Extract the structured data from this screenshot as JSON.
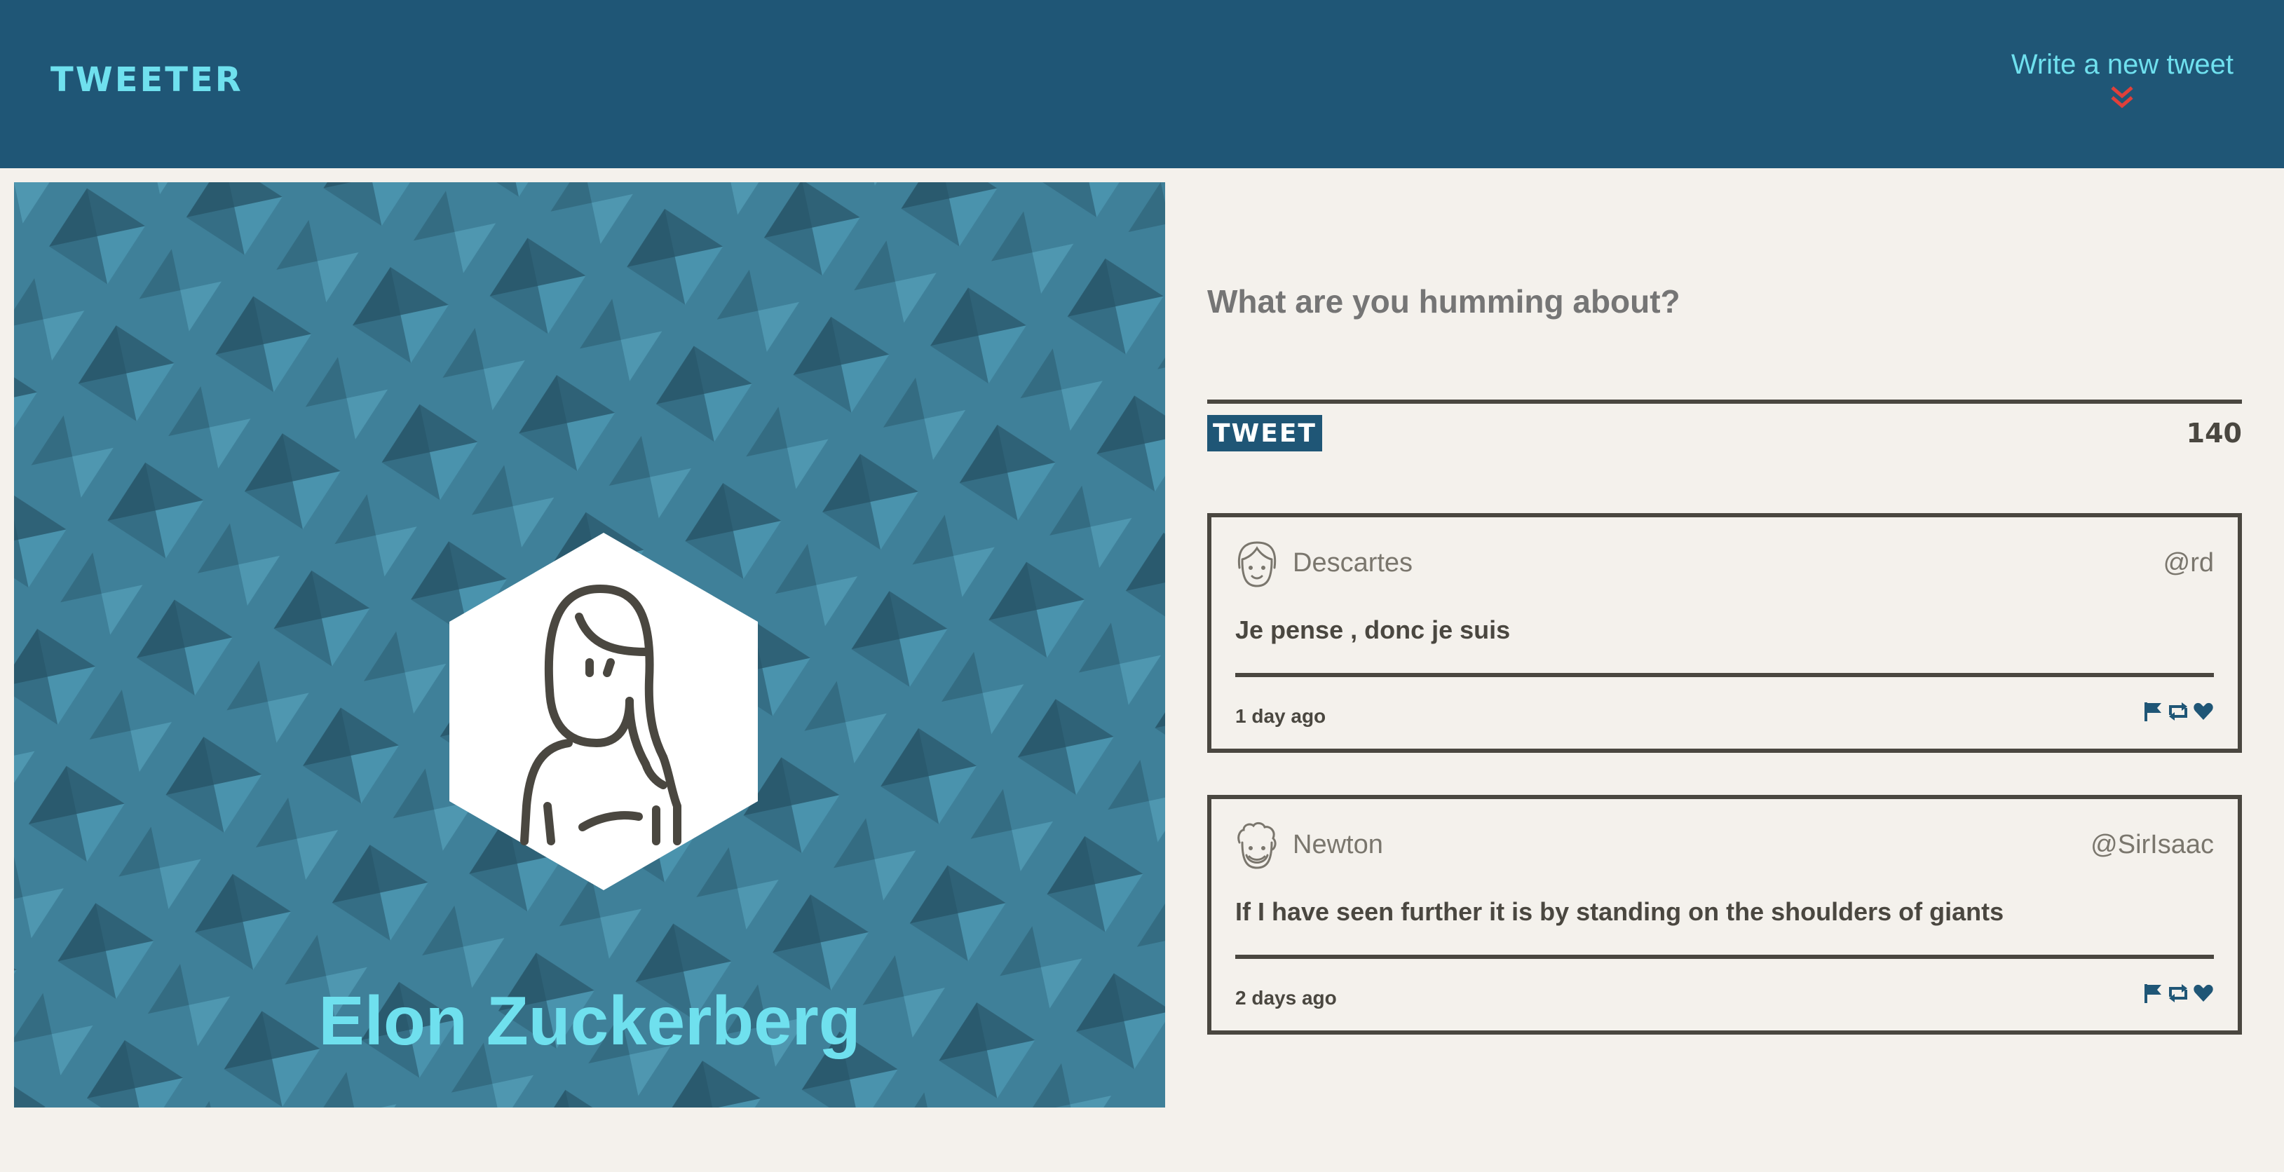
{
  "header": {
    "logo": "TWEETER",
    "compose_link": "Write a new tweet",
    "compose_icon": "double-chevron-down-icon",
    "accent_color": "#6fe0ee",
    "chevron_color": "#e0403a",
    "bar_color": "#1f5676"
  },
  "profile": {
    "name": "Elon Zuckerberg",
    "avatar_icon": "person-hexagon-avatar",
    "background_color": "#3d7f98"
  },
  "composer": {
    "placeholder": "What are you humming about?",
    "button_label": "TWEET",
    "counter": "140"
  },
  "tweets": [
    {
      "name": "Descartes",
      "handle": "@rd",
      "text": "Je pense , donc je suis",
      "age": "1 day ago",
      "avatar_icon": "face-icon"
    },
    {
      "name": "Newton",
      "handle": "@SirIsaac",
      "text": "If I have seen further it is by standing on the shoulders of giants",
      "age": "2 days ago",
      "avatar_icon": "curly-hair-face-icon"
    }
  ],
  "action_icons": [
    "flag-icon",
    "retweet-icon",
    "heart-icon"
  ],
  "action_color": "#1f5676"
}
